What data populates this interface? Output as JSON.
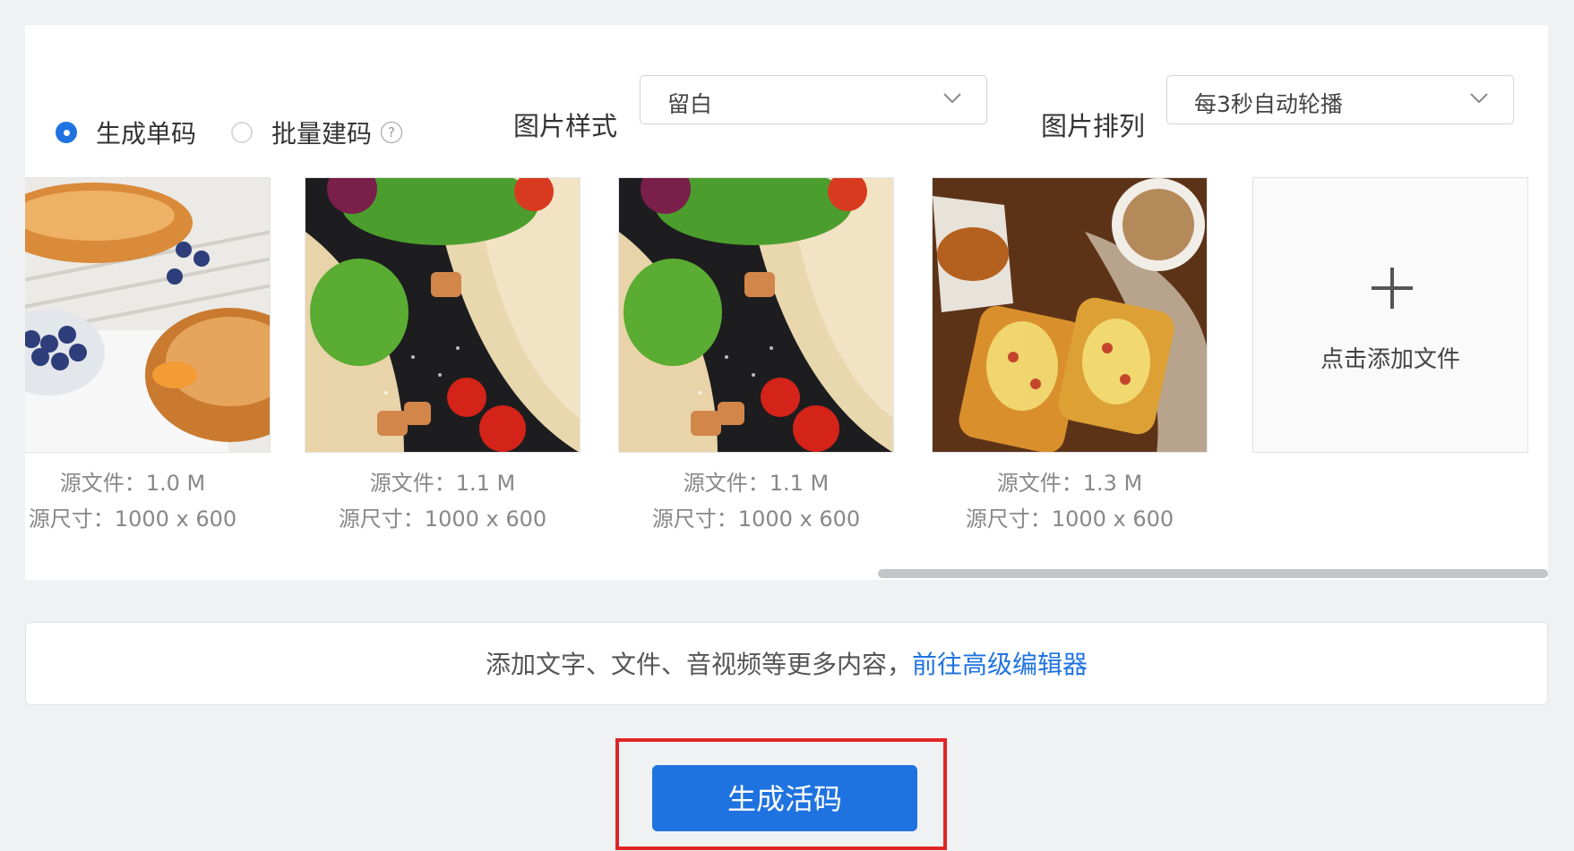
{
  "options": {
    "mode_single": "生成单码",
    "mode_batch": "批量建码",
    "help_icon": "question-circle-icon",
    "image_style_label": "图片样式",
    "image_style_value": "留白",
    "image_arrange_label": "图片排列",
    "image_arrange_value": "每3秒自动轮播"
  },
  "thumbnails": [
    {
      "picture": "croissants with blueberries and tangerines",
      "size": "源文件：1.0 M",
      "dims": "源尺寸：1000 x 600"
    },
    {
      "picture": "tortilla wraps with chicken, lettuce and tomatoes",
      "size": "源文件：1.1 M",
      "dims": "源尺寸：1000 x 600"
    },
    {
      "picture": "tortilla wraps with chicken, lettuce and tomatoes",
      "size": "源文件：1.1 M",
      "dims": "源尺寸：1000 x 600"
    },
    {
      "picture": "cheese toasts with chicken and coffee",
      "size": "源文件：1.3 M",
      "dims": "源尺寸：1000 x 600"
    }
  ],
  "add_file_label": "点击添加文件",
  "editor_bar": {
    "text": "添加文字、文件、音视频等更多内容，",
    "link": "前往高级编辑器"
  },
  "generate_button": "生成活码",
  "colors": {
    "accent": "#1f73e0",
    "highlight": "#e02525"
  }
}
